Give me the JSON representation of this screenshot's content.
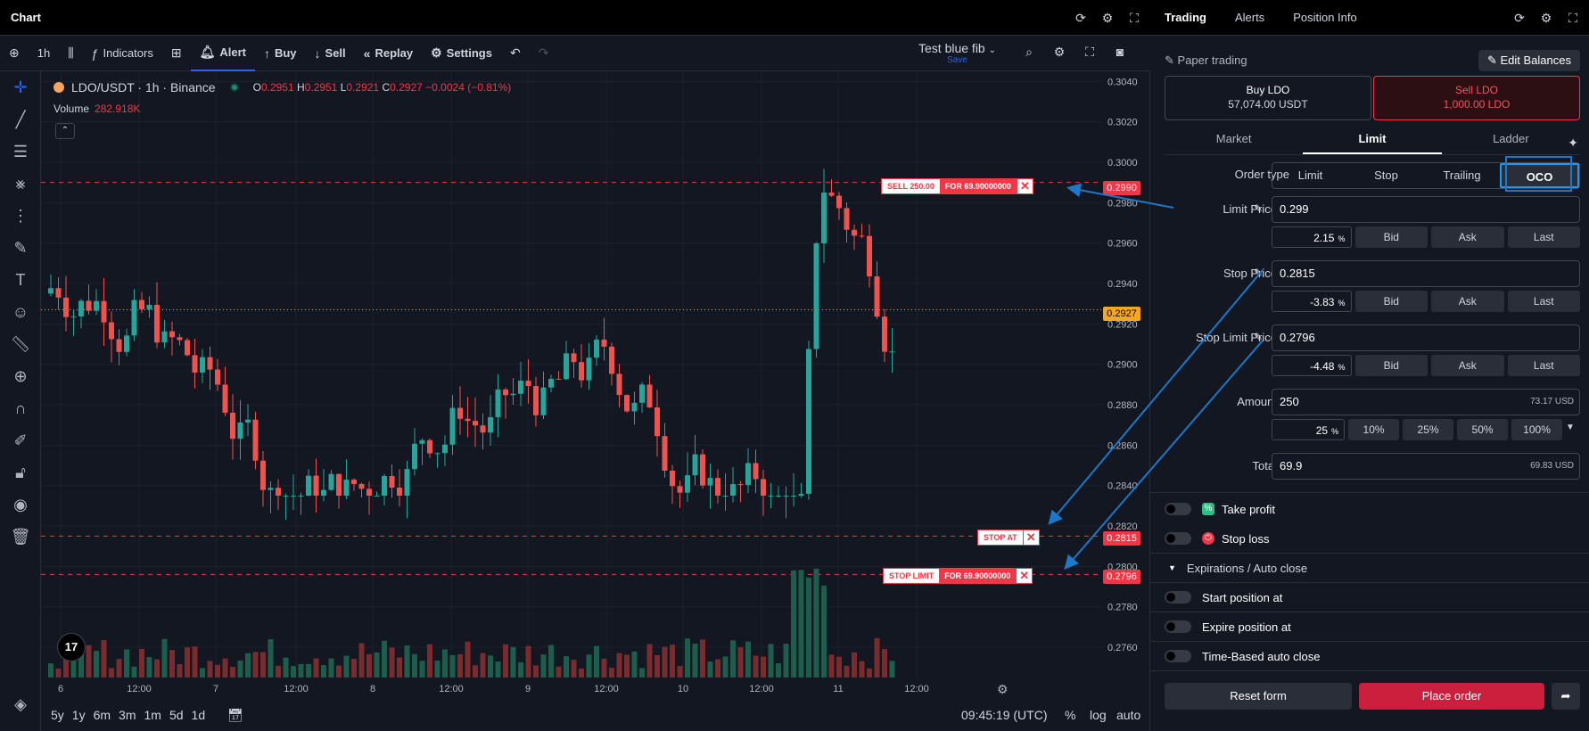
{
  "chart_header": {
    "title": "Chart"
  },
  "toolbar": {
    "interval": "1h",
    "indicators": "Indicators",
    "alert": "Alert",
    "buy": "Buy",
    "sell": "Sell",
    "replay": "Replay",
    "settings": "Settings",
    "layout_name": "Test blue fib",
    "layout_save": "Save"
  },
  "legend": {
    "symbol": "LDO/USDT · 1h · Binance",
    "o_label": "O",
    "o": "0.2951",
    "h_label": "H",
    "h": "0.2951",
    "l_label": "L",
    "l": "0.2921",
    "c_label": "C",
    "c": "0.2927",
    "change": "−0.0024 (−0.81%)",
    "volume_label": "Volume",
    "volume": "282.918K"
  },
  "price_axis": [
    "0.3040",
    "0.3020",
    "0.3000",
    "0.2980",
    "0.2960",
    "0.2940",
    "0.2920",
    "0.2900",
    "0.2880",
    "0.2860",
    "0.2840",
    "0.2820",
    "0.2800",
    "0.2780",
    "0.2760"
  ],
  "time_axis": [
    "6",
    "12:00",
    "7",
    "12:00",
    "8",
    "12:00",
    "9",
    "12:00",
    "10",
    "12:00",
    "11",
    "12:00"
  ],
  "order_lines": {
    "sell": {
      "side": "SELL 250.00",
      "detail": "FOR 69.90000000",
      "price": "0.2990"
    },
    "stop": {
      "side": "STOP AT",
      "price": "0.2815"
    },
    "stop_limit": {
      "side": "STOP LIMIT",
      "detail": "FOR 69.90000000",
      "price": "0.2796"
    },
    "current_price": "0.2927"
  },
  "bottom_bar": {
    "ranges": [
      "5y",
      "1y",
      "6m",
      "3m",
      "1m",
      "5d",
      "1d"
    ],
    "clock": "09:45:19 (UTC)",
    "pct": "%",
    "log": "log",
    "auto": "auto"
  },
  "trading": {
    "tabs": [
      "Trading",
      "Alerts",
      "Position Info"
    ],
    "paper_label": "Paper trading",
    "edit_balances": "Edit Balances",
    "buy_title": "Buy LDO",
    "buy_balance": "57,074.00 USDT",
    "sell_title": "Sell LDO",
    "sell_balance": "1,000.00 LDO",
    "order_tabs": [
      "Market",
      "Limit",
      "Ladder"
    ],
    "order_type_label": "Order type",
    "order_types": [
      "Limit",
      "Stop",
      "Trailing",
      "OCO"
    ],
    "limit_price_label": "Limit Price",
    "limit_price": "0.299",
    "limit_pct": "2.15",
    "stop_price_label": "Stop Price",
    "stop_price": "0.2815",
    "stop_pct": "-3.83",
    "stop_limit_label": "Stop Limit Price",
    "stop_limit_price": "0.2796",
    "stop_limit_pct": "-4.48",
    "pct_sign": "%",
    "bid": "Bid",
    "ask": "Ask",
    "last": "Last",
    "amount_label": "Amount",
    "amount": "250",
    "amount_usd": "73.17 USD",
    "amount_pct": "25",
    "amount_steps": [
      "10%",
      "25%",
      "50%",
      "100%"
    ],
    "total_label": "Total",
    "total": "69.9",
    "total_usd": "69.83 USD",
    "take_profit": "Take profit",
    "stop_loss": "Stop loss",
    "expirations": "Expirations / Auto close",
    "start_position": "Start position at",
    "expire_position": "Expire position at",
    "time_based": "Time-Based auto close",
    "reset": "Reset form",
    "place": "Place order"
  },
  "colors": {
    "up": "#26a69a",
    "down": "#ef5350",
    "accent": "#2962ff",
    "order_red": "#f23645",
    "current_price": "#f5a623",
    "annotation": "#1e78c8"
  }
}
